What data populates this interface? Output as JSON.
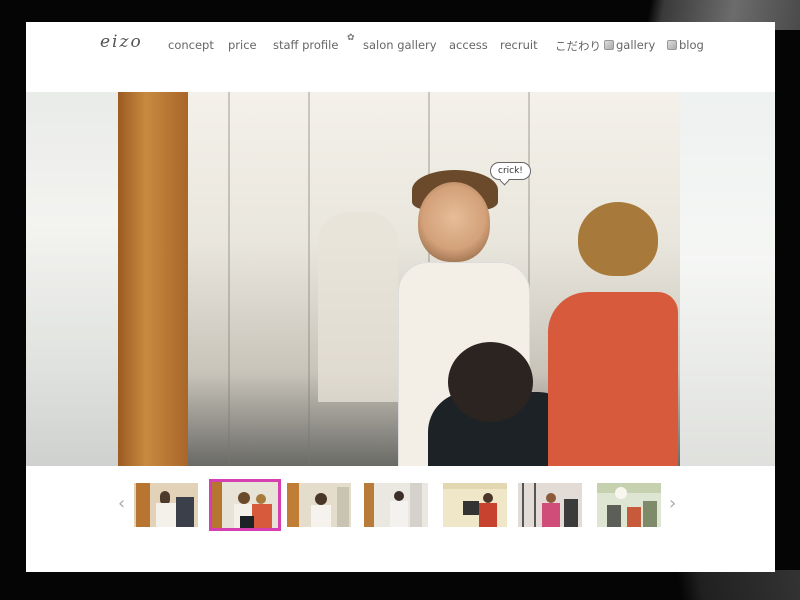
{
  "site": {
    "logo": "eizo",
    "accent_color": "#d63fb2"
  },
  "nav": {
    "items": [
      {
        "label": "concept",
        "icon": null
      },
      {
        "label": "price",
        "icon": null
      },
      {
        "label": "staff profile",
        "icon": null
      },
      {
        "label": "salon gallery",
        "icon": null
      },
      {
        "label": "access",
        "icon": null
      },
      {
        "label": "recruit",
        "icon": null
      },
      {
        "label": "こだわり",
        "icon": null
      },
      {
        "label": "gallery",
        "icon": "gallery-icon"
      },
      {
        "label": "blog",
        "icon": "blog-icon"
      }
    ]
  },
  "hero": {
    "speech_bubble": "crick!"
  },
  "carousel": {
    "prev_label": "‹",
    "next_label": "›",
    "selected_index": 1,
    "thumbnails": [
      {
        "bg": "#c9a678"
      },
      {
        "bg": "#d8b58b"
      },
      {
        "bg": "#d9cbb3"
      },
      {
        "bg": "#d4c7b4"
      },
      {
        "bg": "#e8d6a9"
      },
      {
        "bg": "#d2c6c6"
      },
      {
        "bg": "#b9c4a8"
      }
    ]
  }
}
